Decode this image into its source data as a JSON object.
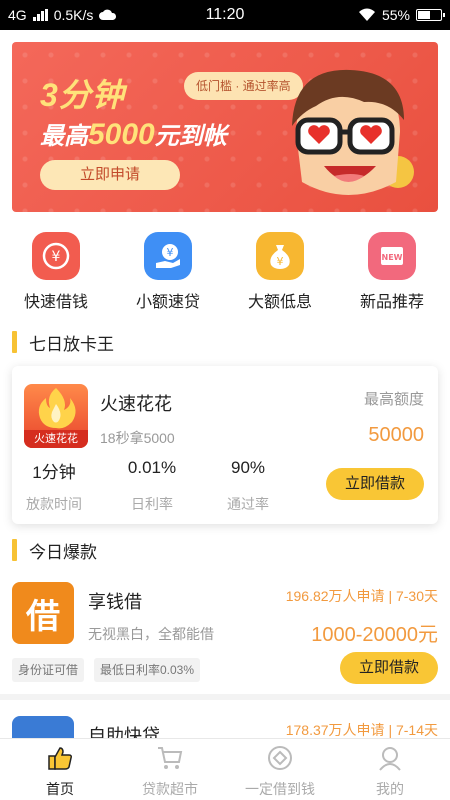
{
  "status_bar": {
    "network": "4G",
    "speed": "0.5K/s",
    "time": "11:20",
    "battery": "55%",
    "battery_level": 0.55
  },
  "banner": {
    "title_line1": "3分钟",
    "title_prefix": "最高",
    "title_amount": "5000",
    "title_suffix": "元到帐",
    "tag": "低门槛 · 通过率高",
    "button": "立即申请"
  },
  "quick_nav": [
    {
      "label": "快速借钱",
      "icon": "yuan-lightning-icon",
      "color": "#f25c4f"
    },
    {
      "label": "小额速贷",
      "icon": "yuan-hand-icon",
      "color": "#3f8ff5"
    },
    {
      "label": "大额低息",
      "icon": "money-bag-icon",
      "color": "#f7b731"
    },
    {
      "label": "新品推荐",
      "icon": "new-card-icon",
      "color": "#f2697d"
    }
  ],
  "section_featured": {
    "title": "七日放卡王"
  },
  "featured": {
    "logo_text": "火速花花",
    "name": "火速花花",
    "sub": "18秒拿5000",
    "max_label": "最高额度",
    "max_value": "50000",
    "stats": [
      {
        "value": "1分钟",
        "label": "放款时间"
      },
      {
        "value": "0.01%",
        "label": "日利率"
      },
      {
        "value": "90%",
        "label": "通过率"
      }
    ],
    "button": "立即借款"
  },
  "section_today": {
    "title": "今日爆款"
  },
  "products": [
    {
      "logo_char": "借",
      "logo_color": "#f08a1c",
      "name": "享钱借",
      "desc": "无视黑白，全都能借",
      "meta": "196.82万人申请 | 7-30天",
      "amount": "1000-20000元",
      "tags": [
        "身份证可借",
        "最低日利率0.03%"
      ],
      "button": "立即借款"
    },
    {
      "logo_char": "",
      "logo_color": "#3a7bd5",
      "name": "自助快贷",
      "meta": "178.37万人申请 | 7-14天"
    }
  ],
  "tabbar": [
    {
      "label": "首页",
      "icon": "thumbs-up-icon",
      "active": true
    },
    {
      "label": "贷款超市",
      "icon": "cart-icon",
      "active": false
    },
    {
      "label": "一定借到钱",
      "icon": "diamond-circle-icon",
      "active": false
    },
    {
      "label": "我的",
      "icon": "user-icon",
      "active": false
    }
  ],
  "colors": {
    "accent_yellow": "#f9c635",
    "amount_orange": "#f29a3f",
    "banner_red": "#e9503f"
  }
}
